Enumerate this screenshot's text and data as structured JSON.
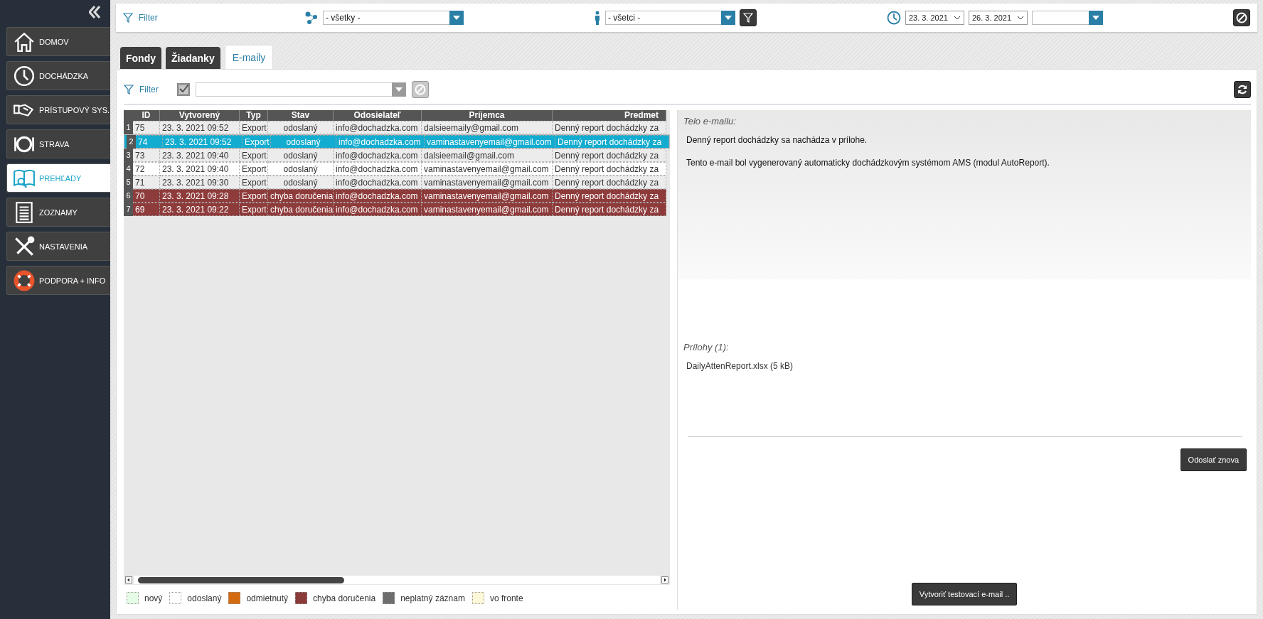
{
  "sidebar": {
    "items": [
      {
        "label": "DOMOV",
        "selected": false
      },
      {
        "label": "DOCHÁDZKA",
        "selected": false
      },
      {
        "label": "PRÍSTUPOVÝ SYS.",
        "selected": false
      },
      {
        "label": "STRAVA",
        "selected": false
      },
      {
        "label": "PREHĽADY",
        "selected": true
      },
      {
        "label": "ZOZNAMY",
        "selected": false
      },
      {
        "label": "NASTAVENIA",
        "selected": false
      },
      {
        "label": "PODPORA + INFO",
        "selected": false
      }
    ]
  },
  "top_filter": {
    "label": "Filter",
    "group_select": "- všetky -",
    "person_select": "- všetci -",
    "date_from": "23. 3. 2021",
    "date_to": "26. 3. 2021"
  },
  "tabs": [
    {
      "label": "Fondy",
      "selected": false
    },
    {
      "label": "Žiadanky",
      "selected": false
    },
    {
      "label": "E-maily",
      "selected": true
    }
  ],
  "filter": {
    "label": "Filter"
  },
  "table": {
    "columns": [
      "ID",
      "Vytvorený",
      "Typ",
      "Stav",
      "Odosielateľ",
      "Príjemca",
      "Predmet"
    ],
    "rows": [
      {
        "num": "1",
        "kind": "sent",
        "selected": false,
        "cells": [
          "75",
          "23. 3. 2021  09:52",
          "Export",
          "odoslaný",
          "info@dochadzka.com",
          " dalsieemaily@gmail.com",
          "Denný report dochádzky za"
        ]
      },
      {
        "num": "2",
        "kind": "sent",
        "selected": true,
        "cells": [
          "74",
          "23. 3. 2021  09:52",
          "Export",
          "odoslaný",
          "info@dochadzka.com",
          "vaminastavenyemail@gmail.com",
          "Denný report dochádzky za"
        ]
      },
      {
        "num": "3",
        "kind": "sent",
        "selected": false,
        "cells": [
          "73",
          "23. 3. 2021  09:40",
          "Export",
          "odoslaný",
          "info@dochadzka.com",
          " dalsieemail@gmail.com",
          "Denný report dochádzky za"
        ]
      },
      {
        "num": "4",
        "kind": "sent",
        "selected": false,
        "cells": [
          "72",
          "23. 3. 2021  09:40",
          "Export",
          "odoslaný",
          "info@dochadzka.com",
          "vaminastavenyemail@gmail.com",
          "Denný report dochádzky za"
        ]
      },
      {
        "num": "5",
        "kind": "sent",
        "selected": false,
        "cells": [
          "71",
          "23. 3. 2021  09:30",
          "Export",
          "odoslaný",
          "info@dochadzka.com",
          "vaminastavenyemail@gmail.com",
          "Denný report dochádzky za"
        ]
      },
      {
        "num": "6",
        "kind": "error",
        "selected": false,
        "cells": [
          "70",
          "23. 3. 2021  09:28",
          "Export",
          "chyba doručenia",
          "info@dochadzka.com",
          "vaminastavenyemail@gmail.com",
          "Denný report dochádzky za"
        ]
      },
      {
        "num": "7",
        "kind": "error",
        "selected": false,
        "cells": [
          "69",
          "23. 3. 2021  09:22",
          "Export",
          "chyba doručenia",
          "info@dochadzka.com",
          "vaminastavenyemail@gmail.com",
          "Denný report dochádzky za"
        ]
      }
    ]
  },
  "legend": [
    {
      "label": "nový",
      "color": "#e6fbe6"
    },
    {
      "label": "odoslaný",
      "color": "#ffffff"
    },
    {
      "label": "odmietnutý",
      "color": "#d46a10"
    },
    {
      "label": "chyba doručenia",
      "color": "#8b3a3a"
    },
    {
      "label": "neplatný záznam",
      "color": "#6e6e6e"
    },
    {
      "label": "vo fronte",
      "color": "#fdf8d8"
    }
  ],
  "detail": {
    "body_label": "Telo e-mailu:",
    "body": [
      "Denný report dochádzky sa nachádza v prílohe.",
      "Tento e-mail bol vygenerovaný automaticky dochádzkovým systémom AMS (modul AutoReport)."
    ],
    "attachments_label": "Prílohy (1):",
    "attachments": [
      "DailyAttenReport.xlsx (5 kB)"
    ],
    "resend_button": "Odoslať znova",
    "test_button": "Vytvoriť testovací e-mail .."
  }
}
